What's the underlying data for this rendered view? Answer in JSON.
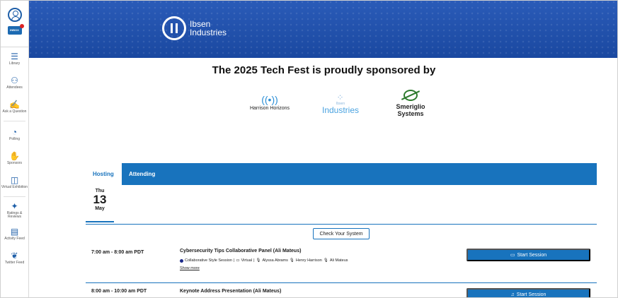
{
  "sidebar": {
    "inbox_label": "INBOX",
    "items": [
      {
        "label": "Library",
        "icon": "library-icon"
      },
      {
        "label": "Attendees",
        "icon": "attendees-icon"
      },
      {
        "label": "Ask a Question",
        "icon": "question-icon"
      },
      {
        "label": "Polling",
        "icon": "polling-icon"
      },
      {
        "label": "Sponsors",
        "icon": "sponsors-icon"
      },
      {
        "label": "Virtual Exhibition",
        "icon": "exhibition-icon"
      },
      {
        "label": "Ratings & Reviews",
        "icon": "ratings-icon"
      },
      {
        "label": "Activity Feed",
        "icon": "activity-feed-icon"
      },
      {
        "label": "Twitter Feed",
        "icon": "twitter-icon"
      }
    ]
  },
  "banner": {
    "logo_line1": "Ibsen",
    "logo_line2": "Industries"
  },
  "sponsors": {
    "heading": "The 2025 Tech Fest is proudly sponsored by",
    "list": [
      {
        "name": "Harrison Horizons"
      },
      {
        "name": "Industries",
        "small": "Ibsen"
      },
      {
        "name_line1": "Smeriglio",
        "name_line2": "Systems"
      }
    ]
  },
  "tabs": {
    "hosting": "Hosting",
    "attending": "Attending"
  },
  "date": {
    "dow": "Thu",
    "day": "13",
    "month": "May"
  },
  "check_system_label": "Check Your System",
  "sessions": [
    {
      "time": "7:00 am - 8:00 am PDT",
      "title": "Cybersecurity Tips Collaborative Panel (Ali Mateus)",
      "type": "Collaborative Style Session",
      "format": "Virtual",
      "speakers": [
        "Alyssa Abrams",
        "Henry Harrison",
        "Ali Mateus"
      ],
      "show_more": "Show more",
      "button": "Start Session"
    },
    {
      "time": "8:00 am - 10:00 am PDT",
      "title": "Keynote Address Presentation (Ali Mateus)",
      "button": "Start Session"
    }
  ],
  "colors": {
    "brand_blue": "#1873bd",
    "banner_blue": "#1e4fa8"
  }
}
